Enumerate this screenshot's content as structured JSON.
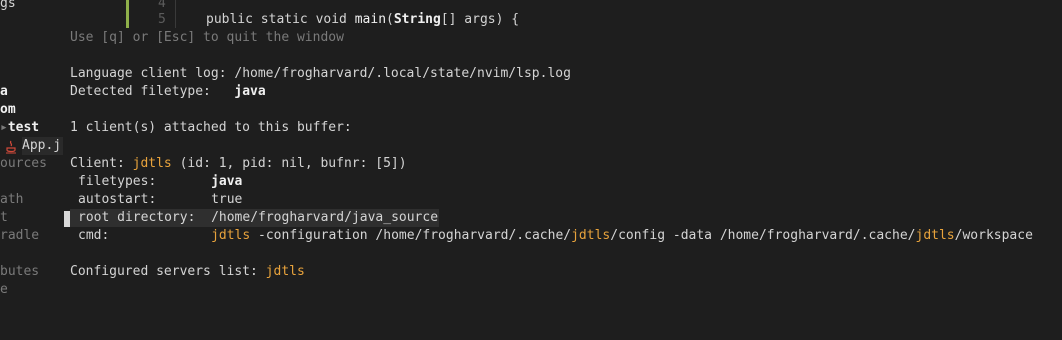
{
  "tree": {
    "items": [
      "gs",
      "a",
      "om",
      "test",
      "App.j",
      "ources",
      "ath",
      "t",
      "radle",
      "butes",
      "e"
    ]
  },
  "editor": {
    "line4_num": "4",
    "line5_num": "5",
    "line5_kw": "public static void ",
    "line5_fn": "main",
    "line5_p1": "(",
    "line5_type": "String",
    "line5_rest": "[] args) {"
  },
  "lspinfo": {
    "hint": "Use [q] or [Esc] to quit the window",
    "log_label": "Language client log: ",
    "log_path": "/home/frogharvard/.local/state/nvim/lsp.log",
    "ft_label": "Detected filetype:   ",
    "ft_value": "java",
    "clients_attached": "1 client(s) attached to this buffer:",
    "client_label": "Client: ",
    "client_name": "jdtls",
    "client_details": " (id: 1, pid: nil, bufnr: [5])",
    "filetypes_label": "filetypes:       ",
    "filetypes_value": "java",
    "autostart_label": "autostart:       ",
    "autostart_value": "true",
    "rootdir_label": "root directory:  ",
    "rootdir_value": "/home/frogharvard/java_source",
    "cmd_label": "cmd:             ",
    "cmd_p1": "jdtls",
    "cmd_p2": " -configuration /home/frogharvard/.cache/",
    "cmd_p3": "jdtls",
    "cmd_p4": "/config -data /home/frogharvard/.cache/",
    "cmd_p5": "jdtls",
    "cmd_p6": "/workspace",
    "servers_label": "Configured servers list: ",
    "servers_value": "jdtls"
  },
  "colors": {
    "background": "#1e1e1e",
    "text": "#d4d4d4",
    "accent_orange": "#e8a33c",
    "git_bar": "#8fb04a",
    "java_icon": "#d0493a"
  }
}
